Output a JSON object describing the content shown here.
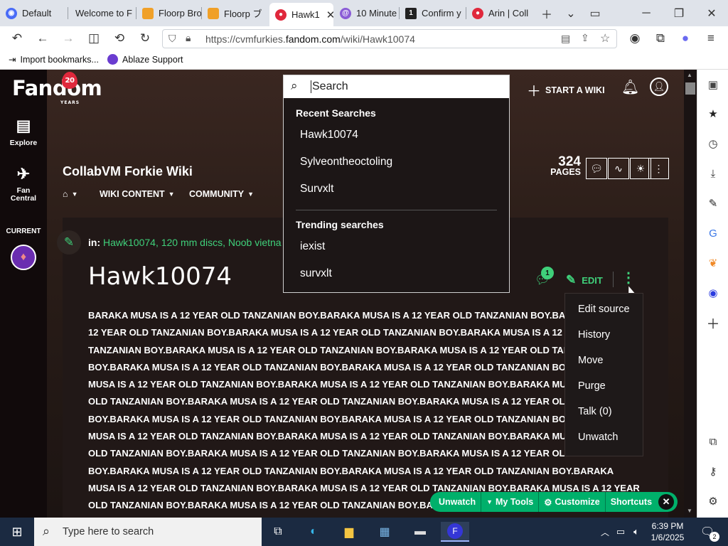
{
  "tabs": [
    {
      "title": "Default",
      "fav": "#4a6cf7"
    },
    {
      "title": "Welcome to F",
      "fav": ""
    },
    {
      "title": "Floorp Bro",
      "fav": "#f0a028"
    },
    {
      "title": "Floorp ブ",
      "fav": "#f0a028"
    },
    {
      "title": "Hawk1",
      "fav": "#e0283c"
    },
    {
      "title": "10 Minute",
      "fav": "#8a5cd6"
    },
    {
      "title": "Confirm y",
      "fav": "#222"
    },
    {
      "title": "Arin | Coll",
      "fav": "#e0283c"
    }
  ],
  "tab_active_index": 4,
  "tab_badge_6": "1",
  "url": {
    "prefix": "https://cvmfurkies.",
    "host": "fandom.com",
    "path": "/wiki/Hawk10074"
  },
  "bookmarks": [
    "Import bookmarks...",
    "Ablaze Support"
  ],
  "fandom": {
    "logo": "Fandom",
    "anniversary": "20",
    "anniversary_sub": "YEARS",
    "rail": [
      "Explore",
      "Fan Central",
      "CURRENT"
    ],
    "start_wiki": "START A WIKI"
  },
  "wiki": {
    "title": "CollabVM Forkie Wiki",
    "nav": [
      "WIKI CONTENT",
      "COMMUNITY"
    ],
    "pages_count": "324",
    "pages_label": "PAGES"
  },
  "search": {
    "placeholder": "Search",
    "recent_heading": "Recent Searches",
    "recent": [
      "Hawk10074",
      "Sylveontheoctoling",
      "Survxlt"
    ],
    "trending_heading": "Trending searches",
    "trending": [
      "iexist",
      "survxlt"
    ]
  },
  "article": {
    "in_label": "in:",
    "categories": "Hawk10074, 120 mm discs, Noob vietna",
    "title": "Hawk10074",
    "comments": "1",
    "edit": "EDIT",
    "lines": [
      "BARAKA MUSA IS A 12 YEAR OLD TANZANIAN BOY.BARAKA MUSA IS A 12 YEAR OLD TANZANIAN BOY.BARAKA",
      "12 YEAR OLD TANZANIAN BOY.BARAKA MUSA IS A 12 YEAR OLD TANZANIAN BOY.BARAKA MUSA IS A 12 YEAR",
      "TANZANIAN BOY.BARAKA MUSA IS A 12 YEAR OLD TANZANIAN BOY.BARAKA MUSA IS A 12 YEAR OLD TANZANIAN",
      "BOY.BARAKA MUSA IS A 12 YEAR OLD TANZANIAN BOY.BARAKA MUSA IS A 12 YEAR OLD TANZANIAN BOY.BARAKA",
      "MUSA IS A 12 YEAR OLD TANZANIAN BOY.BARAKA MUSA IS A 12 YEAR OLD TANZANIAN BOY.BARAKA MUSA IS A 12",
      "OLD TANZANIAN BOY.BARAKA MUSA IS A 12 YEAR OLD TANZANIAN BOY.BARAKA MUSA IS A 12 YEAR OLD TANZANIAN",
      "BOY.BARAKA MUSA IS A 12 YEAR OLD TANZANIAN BOY.BARAKA MUSA IS A 12 YEAR OLD TANZANIAN BOY.BARAKA",
      "MUSA IS A 12 YEAR OLD TANZANIAN BOY.BARAKA MUSA IS A 12 YEAR OLD TANZANIAN BOY.BARAKA MUSA IS A 12",
      "OLD TANZANIAN BOY.BARAKA MUSA IS A 12 YEAR OLD TANZANIAN BOY.BARAKA MUSA IS A 12 YEAR OLD TANZANIAN",
      "BOY.BARAKA MUSA IS A 12 YEAR OLD TANZANIAN BOY.BARAKA MUSA IS A 12 YEAR OLD TANZANIAN BOY.BARAKA",
      "MUSA IS A 12 YEAR OLD TANZANIAN BOY.BARAKA MUSA IS A 12 YEAR OLD TANZANIAN BOY.BARAKA MUSA IS A 12 YEAR",
      "OLD TANZANIAN BOY.BARAKA MUSA IS A 12 YEAR OLD TANZANIAN BOY.BARAKA MUSA IS A 12 YEAR OLD TANZANIAN"
    ]
  },
  "more_menu": [
    "Edit source",
    "History",
    "Move",
    "Purge",
    "Talk (0)",
    "Unwatch"
  ],
  "toolbar": [
    "Unwatch",
    "My Tools",
    "Customize",
    "Shortcuts"
  ],
  "taskbar": {
    "search_placeholder": "Type here to search",
    "time": "6:39 PM",
    "date": "1/6/2025",
    "notif": "2"
  },
  "colors": {
    "accent": "#3fd07a",
    "toolbar": "#00b06b",
    "fandom_red": "#e0283c"
  }
}
